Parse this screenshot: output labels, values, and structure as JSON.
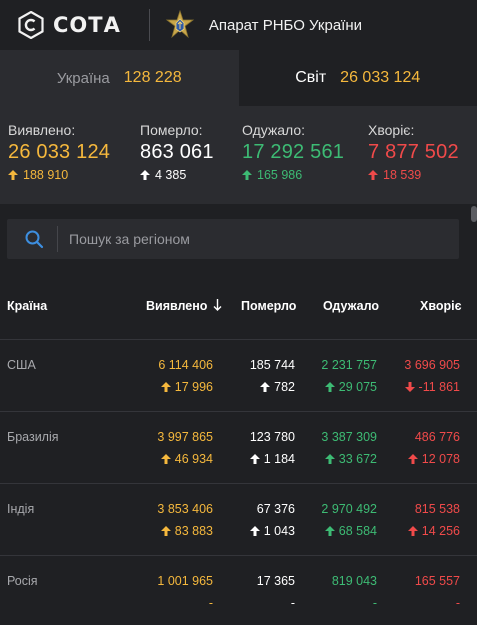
{
  "header": {
    "brand": "СОТА",
    "org": "Апарат РНБО України"
  },
  "tabs": [
    {
      "label": "Україна",
      "value": "128 228"
    },
    {
      "label": "Світ",
      "value": "26 033 124"
    }
  ],
  "summary": [
    {
      "label": "Виявлено:",
      "value": "26 033 124",
      "delta": "188 910",
      "color": "#f5b83d"
    },
    {
      "label": "Померло:",
      "value": "863 061",
      "delta": "4 385",
      "color": "#ffffff"
    },
    {
      "label": "Одужало:",
      "value": "17 292 561",
      "delta": "165 986",
      "color": "#3dbb74"
    },
    {
      "label": "Хворіє:",
      "value": "7 877 502",
      "delta": "18 539",
      "color": "#f04a4a"
    }
  ],
  "search": {
    "placeholder": "Пошук за регіоном"
  },
  "table": {
    "headers": {
      "country": "Країна",
      "confirmed": "Виявлено",
      "deaths": "Померло",
      "recovered": "Одужало",
      "active": "Хворіє"
    },
    "rows": [
      {
        "country": "США",
        "confirmed": "6 114 406",
        "confirmed_d": "17 996",
        "deaths": "185 744",
        "deaths_d": "782",
        "recovered": "2 231 757",
        "recovered_d": "29 075",
        "active": "3 696 905",
        "active_d": "-11 861"
      },
      {
        "country": "Бразилія",
        "confirmed": "3 997 865",
        "confirmed_d": "46 934",
        "deaths": "123 780",
        "deaths_d": "1 184",
        "recovered": "3 387 309",
        "recovered_d": "33 672",
        "active": "486 776",
        "active_d": "12 078"
      },
      {
        "country": "Індія",
        "confirmed": "3 853 406",
        "confirmed_d": "83 883",
        "deaths": "67 376",
        "deaths_d": "1 043",
        "recovered": "2 970 492",
        "recovered_d": "68 584",
        "active": "815 538",
        "active_d": "14 256"
      },
      {
        "country": "Росія",
        "confirmed": "1 001 965",
        "confirmed_d": "-",
        "deaths": "17 365",
        "deaths_d": "-",
        "recovered": "819 043",
        "recovered_d": "-",
        "active": "165 557",
        "active_d": "-"
      }
    ]
  }
}
